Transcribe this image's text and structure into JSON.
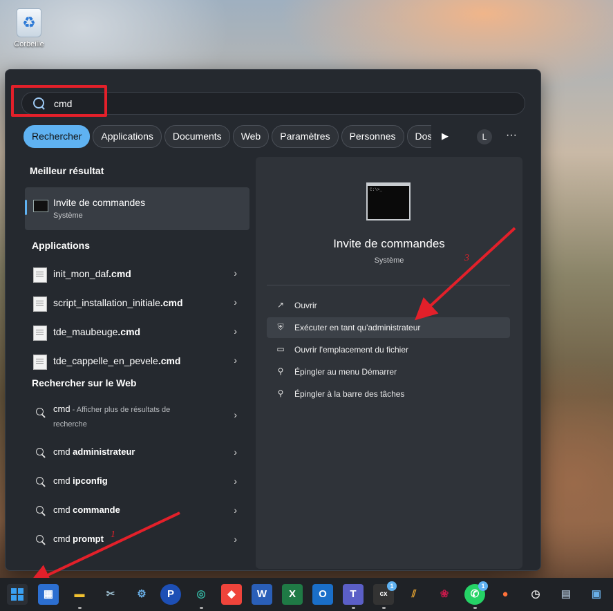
{
  "desktop": {
    "recycle_bin_label": "Corbeille"
  },
  "search": {
    "query": "cmd"
  },
  "tabs": [
    {
      "label": "Rechercher",
      "active": true
    },
    {
      "label": "Applications"
    },
    {
      "label": "Documents"
    },
    {
      "label": "Web"
    },
    {
      "label": "Paramètres"
    },
    {
      "label": "Personnes"
    },
    {
      "label": "Dossiers"
    }
  ],
  "user_initial": "L",
  "best_match": {
    "heading": "Meilleur résultat",
    "name": "Invite de commandes",
    "type": "Système"
  },
  "applications": {
    "heading": "Applications",
    "items": [
      {
        "prefix": "init_mon_daf",
        "ext": ".cmd"
      },
      {
        "prefix": "script_installation_initiale",
        "ext": ".cmd"
      },
      {
        "prefix": "tde_maubeuge",
        "ext": ".cmd"
      },
      {
        "prefix": "tde_cappelle_en_pevele",
        "ext": ".cmd"
      }
    ]
  },
  "web": {
    "heading": "Rechercher sur le Web",
    "first": {
      "query": "cmd",
      "desc": " - Afficher plus de résultats de recherche"
    },
    "items": [
      {
        "base": "cmd ",
        "bold": "administrateur"
      },
      {
        "base": "cmd ",
        "bold": "ipconfig"
      },
      {
        "base": "cmd ",
        "bold": "commande"
      },
      {
        "base": "cmd ",
        "bold": "prompt"
      }
    ]
  },
  "detail": {
    "title": "Invite de commandes",
    "subtitle": "Système",
    "actions": [
      {
        "label": "Ouvrir",
        "icon": "open-icon"
      },
      {
        "label": "Exécuter en tant qu'administrateur",
        "icon": "shield-icon",
        "highlighted": true
      },
      {
        "label": "Ouvrir l'emplacement du fichier",
        "icon": "folder-icon"
      },
      {
        "label": "Épingler au menu Démarrer",
        "icon": "pin-icon"
      },
      {
        "label": "Épingler à la barre des tâches",
        "icon": "pin-icon"
      }
    ]
  },
  "annotations": {
    "one": "1",
    "three": "3"
  },
  "taskbar": {
    "apps": [
      {
        "name": "start"
      },
      {
        "name": "microsoft-store"
      },
      {
        "name": "file-explorer"
      },
      {
        "name": "snipping-tool"
      },
      {
        "name": "control-panel"
      },
      {
        "name": "app-p",
        "glyph": "P"
      },
      {
        "name": "edge"
      },
      {
        "name": "anydesk"
      },
      {
        "name": "word",
        "glyph": "W"
      },
      {
        "name": "excel",
        "glyph": "X"
      },
      {
        "name": "outlook",
        "glyph": "O"
      },
      {
        "name": "teams",
        "glyph": "T"
      },
      {
        "name": "app-cx",
        "badge": "1"
      },
      {
        "name": "app-stripes"
      },
      {
        "name": "raspberry-pi"
      },
      {
        "name": "whatsapp",
        "badge": "1"
      },
      {
        "name": "firefox"
      },
      {
        "name": "clock"
      },
      {
        "name": "calculator"
      },
      {
        "name": "remote-desktop"
      }
    ]
  },
  "colors": {
    "accent": "#5fb2f2",
    "annotation_red": "#e3202a"
  }
}
